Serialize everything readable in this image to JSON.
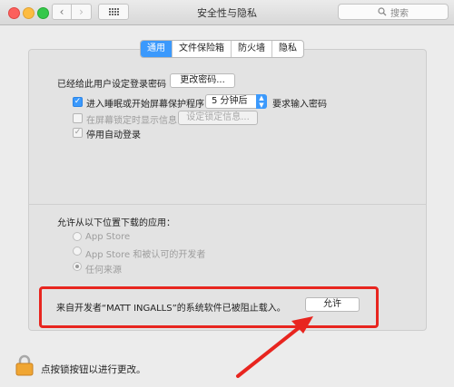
{
  "window": {
    "title": "安全性与隐私",
    "search_placeholder": "搜索"
  },
  "tabs": [
    {
      "label": "通用",
      "active": true
    },
    {
      "label": "文件保险箱",
      "active": false
    },
    {
      "label": "防火墙",
      "active": false
    },
    {
      "label": "隐私",
      "active": false
    }
  ],
  "general": {
    "password_set_label": "已经给此用户设定登录密码",
    "change_password_button": "更改密码...",
    "require_password": {
      "checked": true,
      "prefix": "进入睡眠或开始屏幕保护程序",
      "delay": "5 分钟后",
      "suffix": "要求输入密码"
    },
    "show_message": {
      "checked": false,
      "enabled": false,
      "label": "在屏幕锁定时显示信息",
      "button": "设定锁定信息..."
    },
    "disable_auto_login": {
      "checked": true,
      "enabled": false,
      "label": "停用自动登录"
    }
  },
  "downloads": {
    "heading": "允许从以下位置下载的应用：",
    "options": [
      {
        "label": "App Store",
        "selected": false
      },
      {
        "label": "App Store 和被认可的开发者",
        "selected": false
      },
      {
        "label": "任何来源",
        "selected": true
      }
    ],
    "blocked_message": "来自开发者“MATT INGALLS”的系统软件已被阻止载入。",
    "allow_button": "允许"
  },
  "footer": {
    "lock_text": "点按锁按钮以进行更改。"
  },
  "colors": {
    "accent": "#3b99fc",
    "highlight": "#e8251f"
  }
}
